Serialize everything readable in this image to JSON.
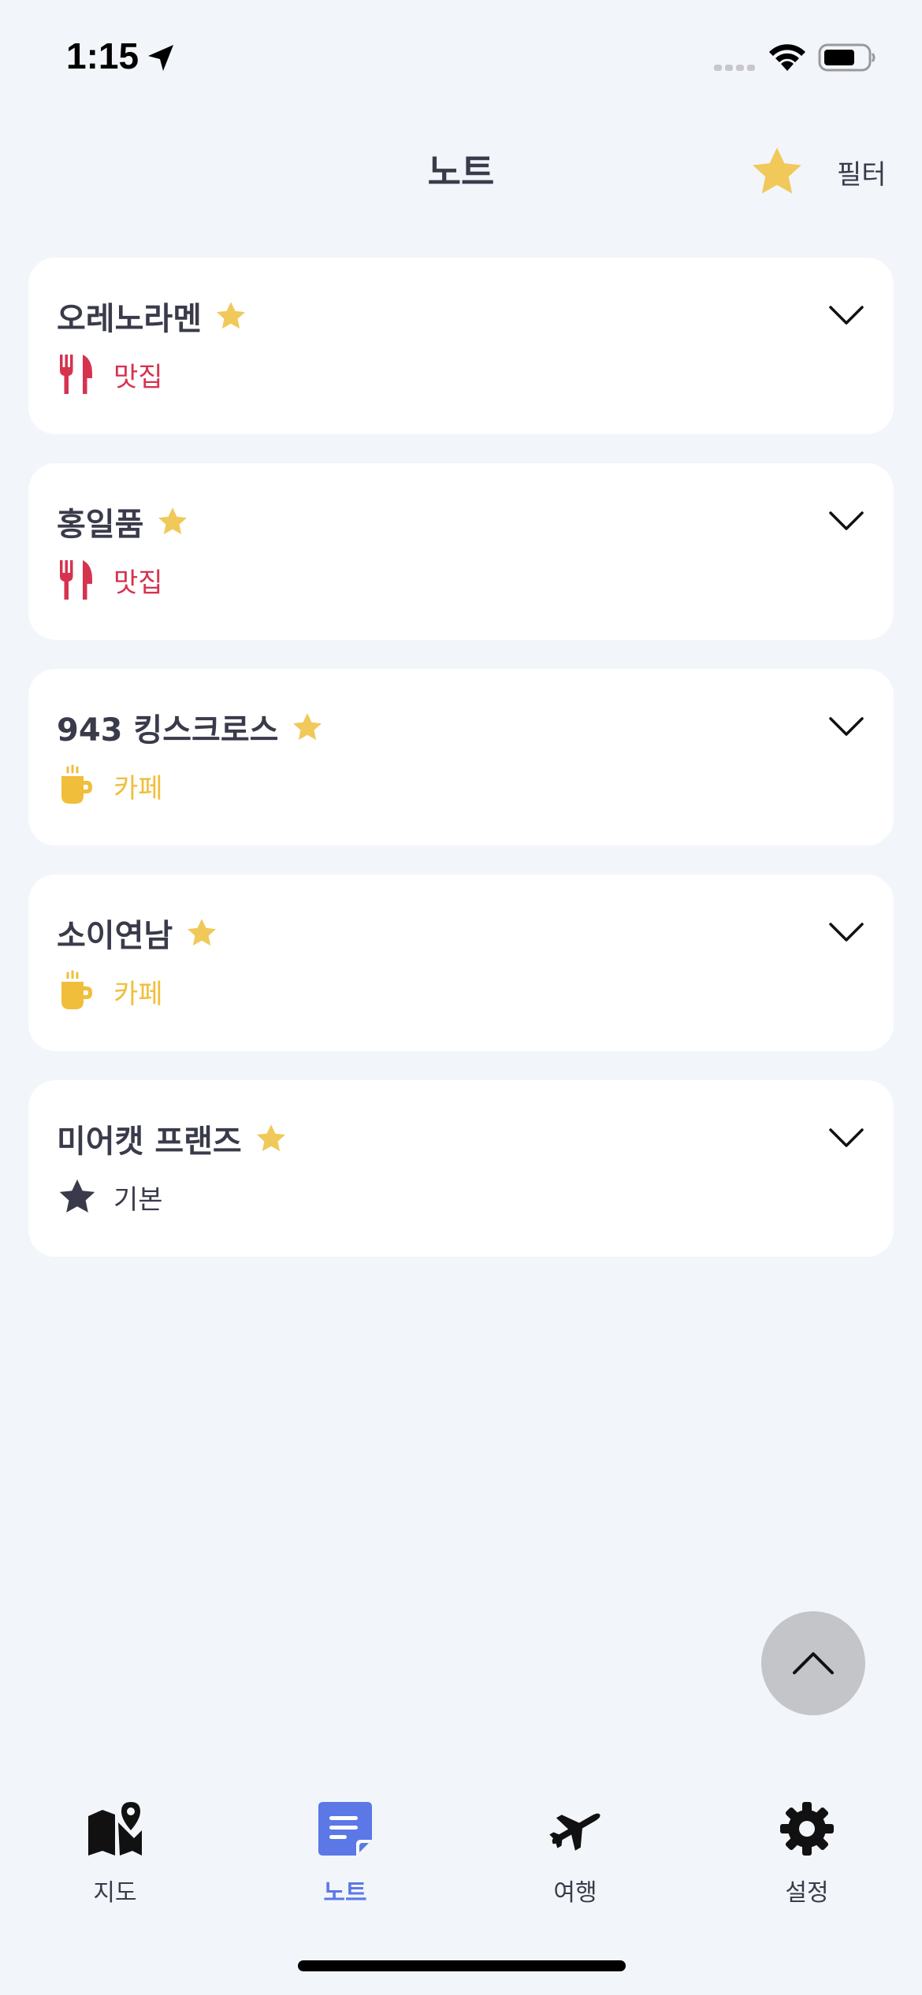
{
  "status_bar": {
    "time": "1:15"
  },
  "header": {
    "title": "노트",
    "filter_label": "필터"
  },
  "notes": [
    {
      "title": "오레노라멘",
      "category": "맛집",
      "category_icon": "fork-knife-icon",
      "category_color": "#d6334f"
    },
    {
      "title": "홍일품",
      "category": "맛집",
      "category_icon": "fork-knife-icon",
      "category_color": "#d6334f"
    },
    {
      "title": "943 킹스크로스",
      "category": "카페",
      "category_icon": "coffee-cup-icon",
      "category_color": "#f0be3a"
    },
    {
      "title": "소이연남",
      "category": "카페",
      "category_icon": "coffee-cup-icon",
      "category_color": "#f0be3a"
    },
    {
      "title": "미어캣 프랜즈",
      "category": "기본",
      "category_icon": "star-icon",
      "category_color": "#3a3b4a"
    }
  ],
  "tabs": [
    {
      "label": "지도",
      "icon": "map-icon",
      "active": false
    },
    {
      "label": "노트",
      "icon": "note-icon",
      "active": true
    },
    {
      "label": "여행",
      "icon": "airplane-icon",
      "active": false
    },
    {
      "label": "설정",
      "icon": "gear-icon",
      "active": false
    }
  ],
  "colors": {
    "accent": "#5b78e6",
    "star": "#f0c95a",
    "background": "#f2f5fa"
  }
}
